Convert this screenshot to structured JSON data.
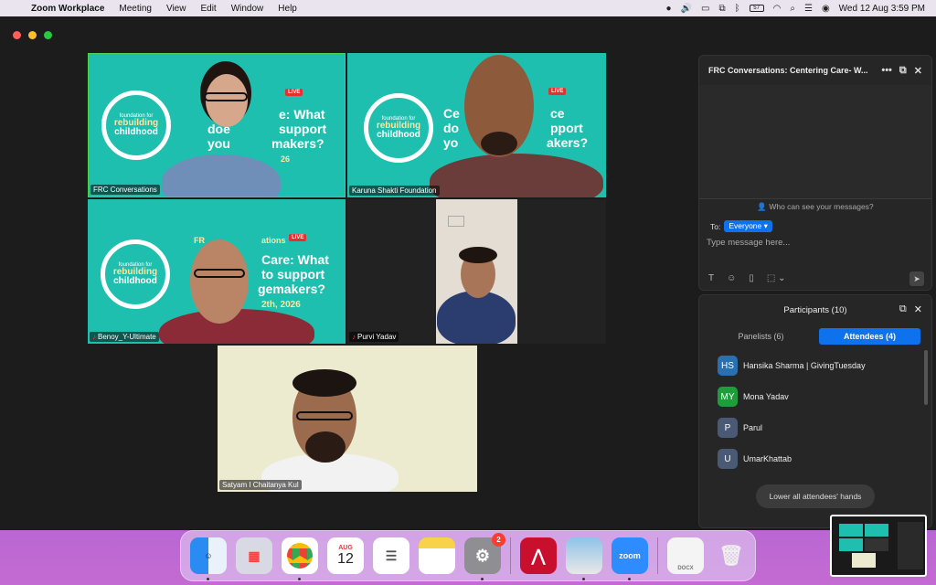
{
  "menubar": {
    "app_name": "Zoom Workplace",
    "menus": [
      "Meeting",
      "View",
      "Edit",
      "Window",
      "Help"
    ],
    "datetime": "Wed 12 Aug  3:59 PM",
    "battery": "57"
  },
  "video": {
    "tiles": [
      {
        "label": "FRC Conversations",
        "mic_off": false
      },
      {
        "label": "Karuna Shakti Foundation",
        "mic_off": false
      },
      {
        "label": "Benoy_Y-Ultimate",
        "mic_off": true
      },
      {
        "label": "Purvi Yadav",
        "mic_off": true
      },
      {
        "label": "Satyam I Chaitanya Kul",
        "mic_off": false
      }
    ],
    "banner": {
      "logo_line1": "foundation for",
      "logo_line2": "rebuilding",
      "logo_line3": "childhood",
      "live": "LIVE",
      "headline_1a": "Ce",
      "headline_1b": "e: What",
      "headline_2a": "doe",
      "headline_2b": "support",
      "headline_3a": "you",
      "headline_3b": "makers?",
      "date_frag_1": "26",
      "headline_b_1": "Ce",
      "headline_b_2": "do",
      "headline_b_3": "yo",
      "headline_b_1b": "ce",
      "headline_b_2b": "pport",
      "headline_b_3b": "akers?",
      "headline_c_1": "Care: What",
      "headline_c_2": "to support",
      "headline_c_3": "gemakers?",
      "headline_c_date": "2th, 2026",
      "headline_c_pre": "FR",
      "headline_c_pre2": "ations"
    }
  },
  "chat": {
    "title": "FRC Conversations: Centering Care- W...",
    "who_can_see": "Who can see your messages?",
    "to_label": "To:",
    "to_value": "Everyone",
    "placeholder": "Type message here..."
  },
  "participants": {
    "title": "Participants (10)",
    "tabs": [
      {
        "label": "Panelists (6)",
        "active": false
      },
      {
        "label": "Attendees (4)",
        "active": true
      }
    ],
    "attendees": [
      {
        "initials": "HS",
        "name": "Hansika Sharma | GivingTuesday",
        "color": "#2a6fb0"
      },
      {
        "initials": "MY",
        "name": "Mona Yadav",
        "color": "#1e9e3a"
      },
      {
        "initials": "P",
        "name": "Parul",
        "color": "#4a5a75"
      },
      {
        "initials": "U",
        "name": "UmarKhattab",
        "color": "#4a5a75"
      }
    ],
    "lower_hands": "Lower all attendees' hands"
  },
  "dock": {
    "calendar_month": "AUG",
    "calendar_day": "12",
    "settings_badge": "2",
    "zoom_label": "zoom",
    "doc_label": "DOCX"
  }
}
